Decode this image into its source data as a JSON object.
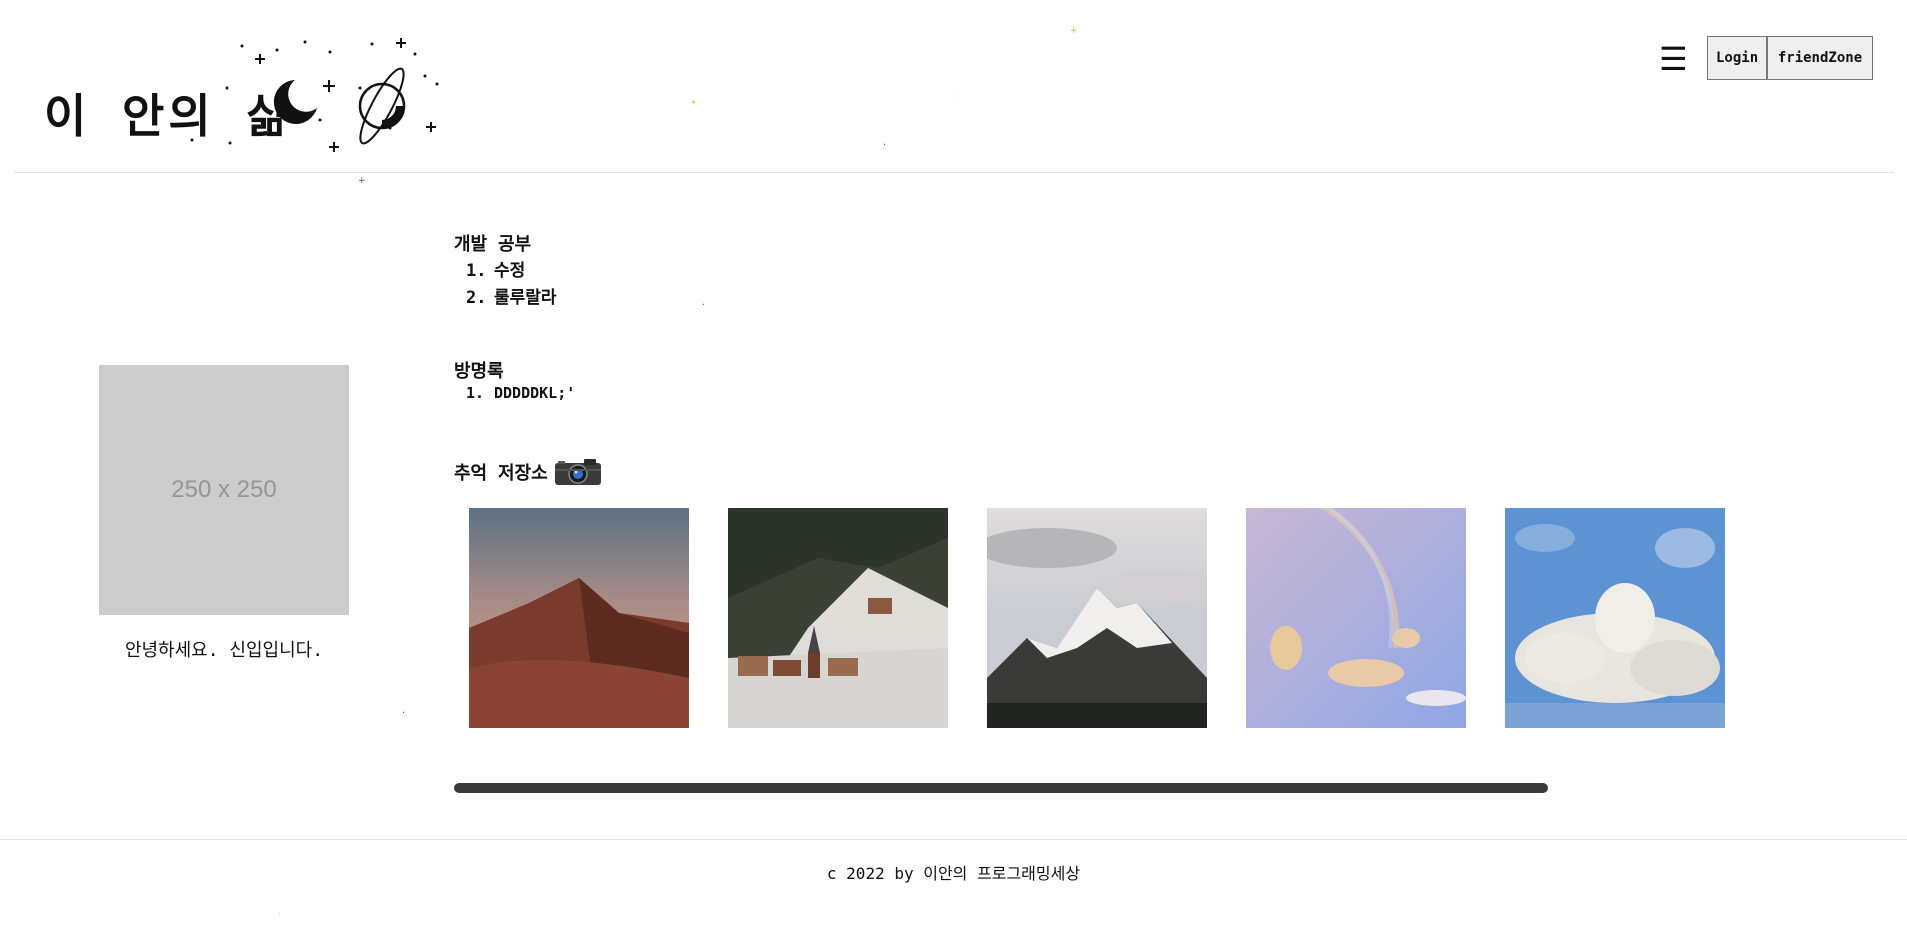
{
  "header": {
    "logo_text": "이 안의 삶",
    "menu_icon": "hamburger-icon",
    "login_label": "Login",
    "friendzone_label": "friendZone"
  },
  "sidebar": {
    "profile_placeholder": "250 x 250",
    "greeting": "안녕하세요. 신입입니다."
  },
  "main": {
    "study": {
      "title": "개발 공부",
      "items": [
        {
          "num": "1.",
          "label": "수정"
        },
        {
          "num": "2.",
          "label": "룰루랄라"
        }
      ]
    },
    "guestbook": {
      "title": "방명록",
      "items": [
        {
          "num": "1.",
          "label": "DDDDDKL;'"
        }
      ]
    },
    "gallery": {
      "title": "추억 저장소",
      "title_icon": "camera-icon",
      "photos": [
        {
          "name": "desert-dunes-photo",
          "colors": [
            "#5d7286",
            "#a58a86",
            "#7a3a2c"
          ]
        },
        {
          "name": "snowy-village-photo",
          "colors": [
            "#3a4034",
            "#d7d5d2",
            "#9a6a4e"
          ]
        },
        {
          "name": "snow-mountain-photo",
          "colors": [
            "#e0dcdc",
            "#bfc3c9",
            "#2b2d2b"
          ]
        },
        {
          "name": "rainbow-sky-photo",
          "colors": [
            "#c9b7d4",
            "#9fb0e4",
            "#e7c89b"
          ]
        },
        {
          "name": "cloud-sky-photo",
          "colors": [
            "#5e93d3",
            "#e8e4e0",
            "#7aa2d6"
          ]
        }
      ]
    }
  },
  "footer": {
    "text": "c 2022 by 이안의 프로그래밍세상"
  },
  "colors": {
    "scrollbar": "#3a3a3a",
    "placeholder_bg": "#cccccc",
    "button_bg": "#efefef"
  }
}
